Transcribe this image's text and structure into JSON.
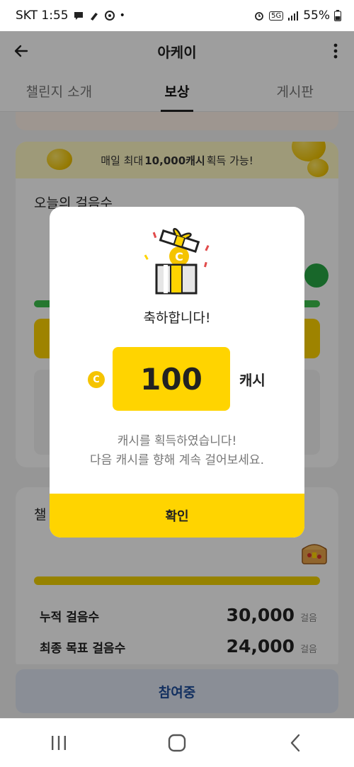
{
  "status_bar": {
    "carrier_time": "SKT 1:55",
    "network": "5G",
    "battery": "55%"
  },
  "app_bar": {
    "title": "아케이"
  },
  "tabs": [
    {
      "label": "챌린지 소개"
    },
    {
      "label": "보상"
    },
    {
      "label": "게시판"
    }
  ],
  "banner": {
    "prefix": "매일 최대",
    "highlight": "10,000캐시",
    "suffix": "획득 가능!"
  },
  "today": {
    "title": "오늘의 걸음수"
  },
  "challenge_card": {
    "title": "챌",
    "stats": [
      {
        "label": "누적 걸음수",
        "value": "30,000",
        "unit": "걸음"
      },
      {
        "label": "최종 목표 걸음수",
        "value": "24,000",
        "unit": "걸음"
      }
    ]
  },
  "join_button": {
    "label": "참여중"
  },
  "dialog": {
    "title": "축하합니다!",
    "coin_symbol": "C",
    "amount": "100",
    "unit": "캐시",
    "message_line1": "캐시를 획득하였습니다!",
    "message_line2": "다음 캐시를 향해 계속 걸어보세요.",
    "confirm_label": "확인"
  },
  "colors": {
    "accent_yellow": "#ffd400",
    "green": "#3cc04d",
    "join_text": "#1f4e9c"
  }
}
